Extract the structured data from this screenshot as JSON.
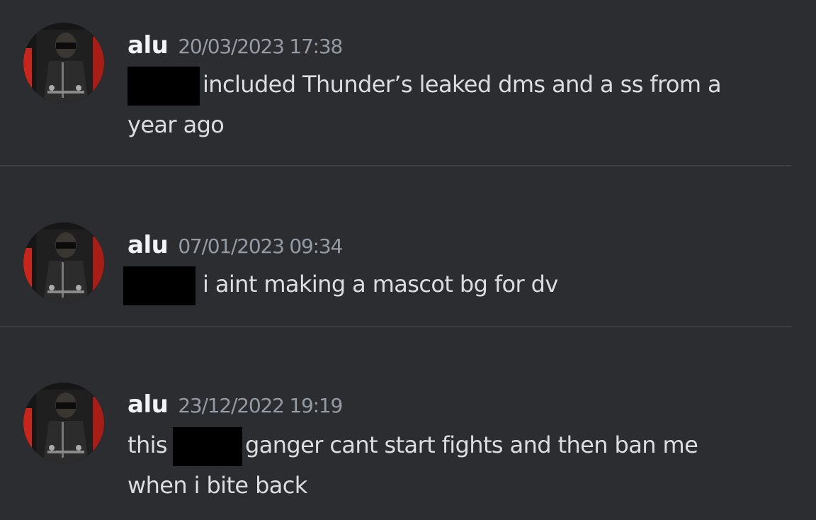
{
  "messages": [
    {
      "username": "alu",
      "timestamp": "20/03/2023 17:38",
      "text_before": "",
      "text_after": "included Thunder’s leaked dms and a ss from a",
      "text_line2": "year ago"
    },
    {
      "username": "alu",
      "timestamp": "07/01/2023 09:34",
      "text_before": "",
      "text_after": "i aint making a mascot bg for dv",
      "text_line2": ""
    },
    {
      "username": "alu",
      "timestamp": "23/12/2022 19:19",
      "text_before": "this",
      "text_after": "ganger cant start fights and then ban me",
      "text_line2": "when i bite back"
    }
  ],
  "colors": {
    "background": "#2b2d31",
    "username": "#f2f3f5",
    "timestamp": "#949ba4",
    "message_text": "#dbdee1",
    "redaction": "#000000",
    "avatar_accent": "#c8261c"
  },
  "icons": {
    "avatar": "user-avatar-photo"
  }
}
